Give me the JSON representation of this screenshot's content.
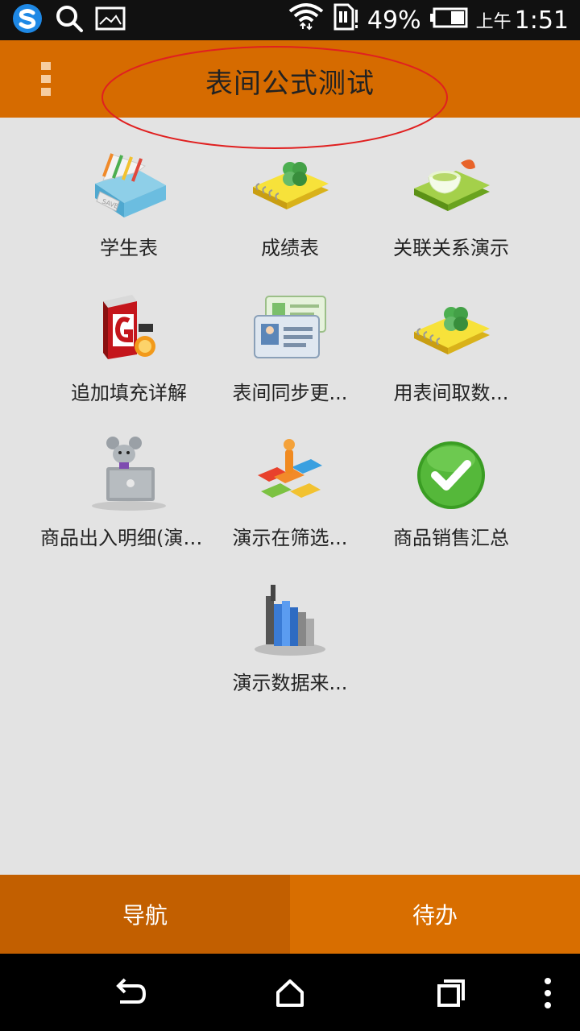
{
  "status_bar": {
    "battery_percent": "49%",
    "time_prefix": "上午",
    "time": "1:51",
    "icons": [
      "sogou-logo-icon",
      "search-icon",
      "image-icon",
      "wifi-icon",
      "sim-icon",
      "battery-icon"
    ]
  },
  "header": {
    "title": "表间公式测试",
    "menu_icon": "overflow-menu-icon",
    "annotation_color": "#e02020"
  },
  "grid": {
    "items": [
      {
        "label": "学生表",
        "icon": "save-folder-icon"
      },
      {
        "label": "成绩表",
        "icon": "clover-notebook-icon"
      },
      {
        "label": "关联关系演示",
        "icon": "tea-cup-book-icon"
      },
      {
        "label": "追加填充详解",
        "icon": "red-g-box-icon"
      },
      {
        "label": "表间同步更...",
        "icon": "id-cards-icon"
      },
      {
        "label": "用表间取数...",
        "icon": "clover-notebook-icon"
      },
      {
        "label": "商品出入明细(演示 ...",
        "icon": "mouse-laptop-icon"
      },
      {
        "label": "演示在筛选...",
        "icon": "puzzle-person-icon"
      },
      {
        "label": "商品销售汇总",
        "icon": "green-check-icon"
      },
      {
        "label": "演示数据来...",
        "icon": "bar-chart-icon"
      }
    ]
  },
  "tabs": [
    {
      "label": "导航",
      "active": true
    },
    {
      "label": "待办",
      "active": false
    }
  ],
  "colors": {
    "accent": "#d66b00",
    "tab_active": "#c25f00",
    "background": "#e3e3e3"
  },
  "nav_bar": {
    "icons": [
      "back-icon",
      "home-icon",
      "recents-icon",
      "more-icon"
    ]
  }
}
